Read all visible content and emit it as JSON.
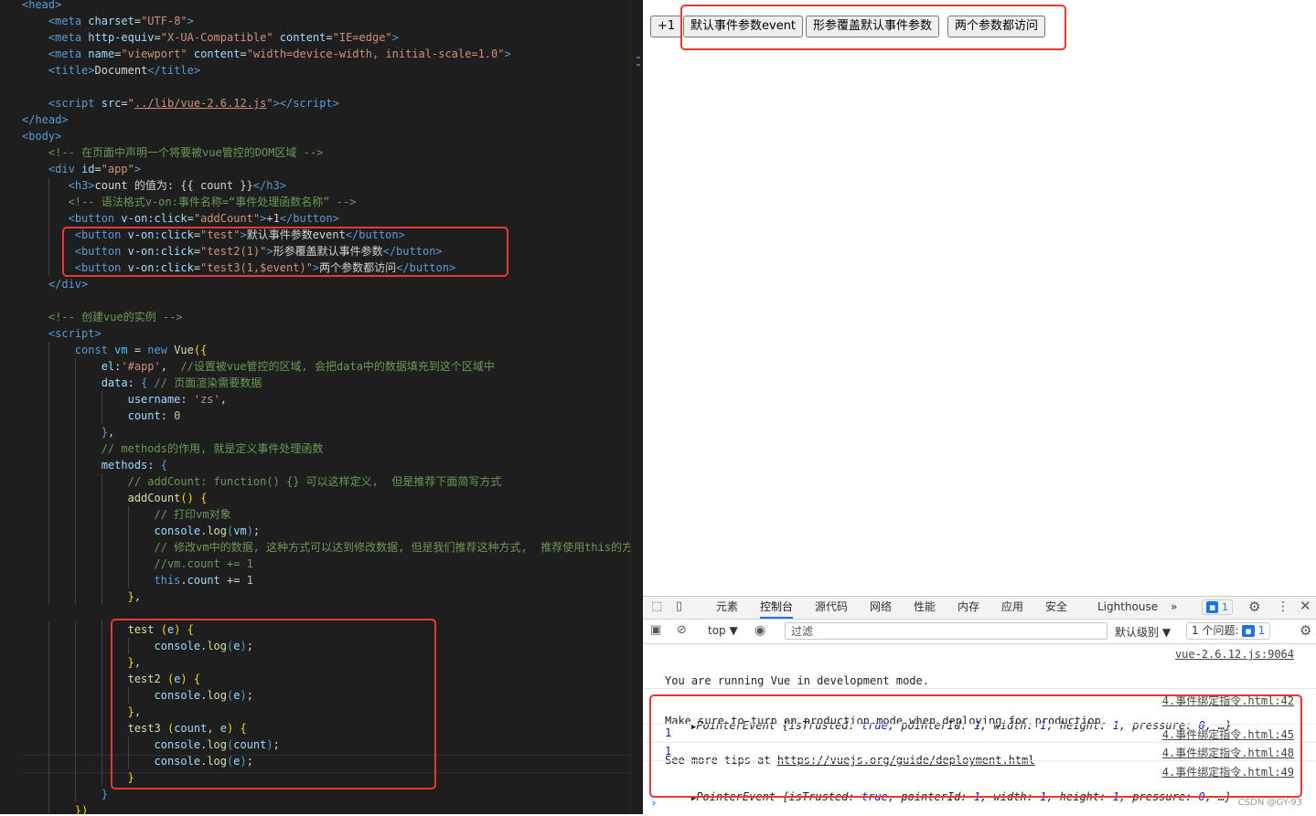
{
  "editor": {
    "lines": [
      [
        [
          "t",
          "<"
        ],
        [
          "t",
          "head"
        ],
        [
          "t",
          ">"
        ]
      ],
      [
        [
          "d",
          "    "
        ],
        [
          "t",
          "<"
        ],
        [
          "t",
          "meta "
        ],
        [
          "a",
          "charset"
        ],
        [
          "d",
          "="
        ],
        [
          "s",
          "\"UTF-8\""
        ],
        [
          "t",
          ">"
        ]
      ],
      [
        [
          "d",
          "    "
        ],
        [
          "t",
          "<"
        ],
        [
          "t",
          "meta "
        ],
        [
          "a",
          "http-equiv"
        ],
        [
          "d",
          "="
        ],
        [
          "s",
          "\"X-UA-Compatible\""
        ],
        [
          "d",
          " "
        ],
        [
          "a",
          "content"
        ],
        [
          "d",
          "="
        ],
        [
          "s",
          "\"IE=edge\""
        ],
        [
          "t",
          ">"
        ]
      ],
      [
        [
          "d",
          "    "
        ],
        [
          "t",
          "<"
        ],
        [
          "t",
          "meta "
        ],
        [
          "a",
          "name"
        ],
        [
          "d",
          "="
        ],
        [
          "s",
          "\"viewport\""
        ],
        [
          "d",
          " "
        ],
        [
          "a",
          "content"
        ],
        [
          "d",
          "="
        ],
        [
          "s",
          "\"width=device-width, initial-scale=1.0\""
        ],
        [
          "t",
          ">"
        ]
      ],
      [
        [
          "d",
          "    "
        ],
        [
          "t",
          "<"
        ],
        [
          "t",
          "title"
        ],
        [
          "t",
          ">"
        ],
        [
          "d",
          "Document"
        ],
        [
          "t",
          "</"
        ],
        [
          "t",
          "title"
        ],
        [
          "t",
          ">"
        ]
      ],
      [
        [
          "d",
          ""
        ]
      ],
      [
        [
          "d",
          "    "
        ],
        [
          "t",
          "<"
        ],
        [
          "t",
          "script "
        ],
        [
          "a",
          "src"
        ],
        [
          "d",
          "="
        ],
        [
          "s",
          "\""
        ],
        [
          "u",
          "../lib/vue-2.6.12.js"
        ],
        [
          "s",
          "\""
        ],
        [
          "t",
          "></"
        ],
        [
          "t",
          "script"
        ],
        [
          "t",
          ">"
        ]
      ],
      [
        [
          "t",
          "</"
        ],
        [
          "t",
          "head"
        ],
        [
          "t",
          ">"
        ]
      ],
      [
        [
          "t",
          "<"
        ],
        [
          "t",
          "body"
        ],
        [
          "t",
          ">"
        ]
      ],
      [
        [
          "d",
          "    "
        ],
        [
          "c",
          "<!-- 在页面中声明一个将要被vue管控的DOM区域 -->"
        ]
      ],
      [
        [
          "d",
          "    "
        ],
        [
          "t",
          "<"
        ],
        [
          "t",
          "div "
        ],
        [
          "a",
          "id"
        ],
        [
          "d",
          "="
        ],
        [
          "s",
          "\"app\""
        ],
        [
          "t",
          ">"
        ]
      ],
      [
        [
          "d",
          "       "
        ],
        [
          "t",
          "<"
        ],
        [
          "t",
          "h3"
        ],
        [
          "t",
          ">"
        ],
        [
          "d",
          "count 的值为: {{ count }}"
        ],
        [
          "t",
          "</"
        ],
        [
          "t",
          "h3"
        ],
        [
          "t",
          ">"
        ]
      ],
      [
        [
          "d",
          "       "
        ],
        [
          "c",
          "<!-- 语法格式v-on:事件名称=“事件处理函数名称” -->"
        ]
      ],
      [
        [
          "d",
          "       "
        ],
        [
          "t",
          "<"
        ],
        [
          "t",
          "button "
        ],
        [
          "a",
          "v-on:click"
        ],
        [
          "d",
          "="
        ],
        [
          "s",
          "\"addCount\""
        ],
        [
          "t",
          ">"
        ],
        [
          "d",
          "+1"
        ],
        [
          "t",
          "</"
        ],
        [
          "t",
          "button"
        ],
        [
          "t",
          ">"
        ]
      ],
      [
        [
          "d",
          "        "
        ],
        [
          "t",
          "<"
        ],
        [
          "t",
          "button "
        ],
        [
          "a",
          "v-on:click"
        ],
        [
          "d",
          "="
        ],
        [
          "s",
          "\"test\""
        ],
        [
          "t",
          ">"
        ],
        [
          "d",
          "默认事件参数event"
        ],
        [
          "t",
          "</"
        ],
        [
          "t",
          "button"
        ],
        [
          "t",
          ">"
        ]
      ],
      [
        [
          "d",
          "        "
        ],
        [
          "t",
          "<"
        ],
        [
          "t",
          "button "
        ],
        [
          "a",
          "v-on:click"
        ],
        [
          "d",
          "="
        ],
        [
          "s",
          "\"test2(1)\""
        ],
        [
          "t",
          ">"
        ],
        [
          "d",
          "形参覆盖默认事件参数"
        ],
        [
          "t",
          "</"
        ],
        [
          "t",
          "button"
        ],
        [
          "t",
          ">"
        ]
      ],
      [
        [
          "d",
          "        "
        ],
        [
          "t",
          "<"
        ],
        [
          "t",
          "button "
        ],
        [
          "a",
          "v-on:click"
        ],
        [
          "d",
          "="
        ],
        [
          "s",
          "\"test3(1,$event)\""
        ],
        [
          "t",
          ">"
        ],
        [
          "d",
          "两个参数都访问"
        ],
        [
          "t",
          "</"
        ],
        [
          "t",
          "button"
        ],
        [
          "t",
          ">"
        ]
      ],
      [
        [
          "d",
          "    "
        ],
        [
          "t",
          "</"
        ],
        [
          "t",
          "div"
        ],
        [
          "t",
          ">"
        ]
      ],
      [
        [
          "d",
          ""
        ]
      ],
      [
        [
          "d",
          "    "
        ],
        [
          "c",
          "<!-- 创建vue的实例 -->"
        ]
      ],
      [
        [
          "d",
          "    "
        ],
        [
          "t",
          "<"
        ],
        [
          "t",
          "script"
        ],
        [
          "t",
          ">"
        ]
      ],
      [
        [
          "d",
          "        "
        ],
        [
          "k",
          "const "
        ],
        [
          "v",
          "vm"
        ],
        [
          "d",
          " = "
        ],
        [
          "k",
          "new "
        ],
        [
          "f",
          "Vue"
        ],
        [
          "y",
          "({"
        ]
      ],
      [
        [
          "d",
          "            "
        ],
        [
          "a",
          "el"
        ],
        [
          "d",
          ":"
        ],
        [
          "s",
          "'#app'"
        ],
        [
          "d",
          ",  "
        ],
        [
          "c",
          "//设置被vue管控的区域, 会把data中的数据填充到这个区域中"
        ]
      ],
      [
        [
          "d",
          "            "
        ],
        [
          "a",
          "data"
        ],
        [
          "d",
          ": "
        ],
        [
          "k",
          "{"
        ],
        [
          "d",
          " "
        ],
        [
          "c",
          "// 页面渲染需要数据"
        ]
      ],
      [
        [
          "d",
          "                "
        ],
        [
          "a",
          "username"
        ],
        [
          "d",
          ": "
        ],
        [
          "s",
          "'zs'"
        ],
        [
          "d",
          ","
        ]
      ],
      [
        [
          "d",
          "                "
        ],
        [
          "a",
          "count"
        ],
        [
          "d",
          ": "
        ],
        [
          "n",
          "0"
        ]
      ],
      [
        [
          "d",
          "            "
        ],
        [
          "k",
          "}"
        ],
        [
          "d",
          ","
        ]
      ],
      [
        [
          "d",
          "            "
        ],
        [
          "c",
          "// methods的作用, 就是定义事件处理函数"
        ]
      ],
      [
        [
          "d",
          "            "
        ],
        [
          "a",
          "methods"
        ],
        [
          "d",
          ": "
        ],
        [
          "k",
          "{"
        ]
      ],
      [
        [
          "d",
          "                "
        ],
        [
          "c",
          "// addCount: function() {} 可以这样定义,  但是推荐下面简写方式"
        ]
      ],
      [
        [
          "d",
          "                "
        ],
        [
          "f",
          "addCount"
        ],
        [
          "y",
          "()"
        ],
        [
          "d",
          " "
        ],
        [
          "y",
          "{"
        ]
      ],
      [
        [
          "d",
          "                    "
        ],
        [
          "c",
          "// 打印vm对象"
        ]
      ],
      [
        [
          "d",
          "                    "
        ],
        [
          "a",
          "console"
        ],
        [
          "d",
          "."
        ],
        [
          "f",
          "log"
        ],
        [
          "k",
          "("
        ],
        [
          "a",
          "vm"
        ],
        [
          "k",
          ")"
        ],
        [
          "d",
          ";"
        ]
      ],
      [
        [
          "d",
          "                    "
        ],
        [
          "c",
          "// 修改vm中的数据, 这种方式可以达到修改数据, 但是我们推荐这种方式,  推荐使用this的方"
        ]
      ],
      [
        [
          "d",
          "                    "
        ],
        [
          "c",
          "//vm.count += 1"
        ]
      ],
      [
        [
          "d",
          "                    "
        ],
        [
          "k",
          "this"
        ],
        [
          "d",
          "."
        ],
        [
          "a",
          "count"
        ],
        [
          "d",
          " += "
        ],
        [
          "n",
          "1"
        ]
      ],
      [
        [
          "d",
          "                "
        ],
        [
          "y",
          "}"
        ],
        [
          "d",
          ","
        ]
      ],
      [
        [
          "d",
          ""
        ]
      ],
      [
        [
          "d",
          "                "
        ],
        [
          "f",
          "test"
        ],
        [
          "d",
          " "
        ],
        [
          "y",
          "("
        ],
        [
          "a",
          "e"
        ],
        [
          "y",
          ")"
        ],
        [
          "d",
          " "
        ],
        [
          "y",
          "{"
        ]
      ],
      [
        [
          "d",
          "                    "
        ],
        [
          "a",
          "console"
        ],
        [
          "d",
          "."
        ],
        [
          "f",
          "log"
        ],
        [
          "k",
          "("
        ],
        [
          "a",
          "e"
        ],
        [
          "k",
          ")"
        ],
        [
          "d",
          ";"
        ]
      ],
      [
        [
          "d",
          "                "
        ],
        [
          "y",
          "}"
        ],
        [
          "d",
          ","
        ]
      ],
      [
        [
          "d",
          "                "
        ],
        [
          "f",
          "test2"
        ],
        [
          "d",
          " "
        ],
        [
          "y",
          "("
        ],
        [
          "a",
          "e"
        ],
        [
          "y",
          ")"
        ],
        [
          "d",
          " "
        ],
        [
          "y",
          "{"
        ]
      ],
      [
        [
          "d",
          "                    "
        ],
        [
          "a",
          "console"
        ],
        [
          "d",
          "."
        ],
        [
          "f",
          "log"
        ],
        [
          "k",
          "("
        ],
        [
          "a",
          "e"
        ],
        [
          "k",
          ")"
        ],
        [
          "d",
          ";"
        ]
      ],
      [
        [
          "d",
          "                "
        ],
        [
          "y",
          "}"
        ],
        [
          "d",
          ","
        ]
      ],
      [
        [
          "d",
          "                "
        ],
        [
          "f",
          "test3"
        ],
        [
          "d",
          " "
        ],
        [
          "y",
          "("
        ],
        [
          "a",
          "count"
        ],
        [
          "d",
          ", "
        ],
        [
          "a",
          "e"
        ],
        [
          "y",
          ")"
        ],
        [
          "d",
          " "
        ],
        [
          "y",
          "{"
        ]
      ],
      [
        [
          "d",
          "                    "
        ],
        [
          "a",
          "console"
        ],
        [
          "d",
          "."
        ],
        [
          "f",
          "log"
        ],
        [
          "k",
          "("
        ],
        [
          "a",
          "count"
        ],
        [
          "k",
          ")"
        ],
        [
          "d",
          ";"
        ]
      ],
      [
        [
          "d",
          "                    "
        ],
        [
          "a",
          "console"
        ],
        [
          "d",
          "."
        ],
        [
          "f",
          "log"
        ],
        [
          "k",
          "("
        ],
        [
          "a",
          "e"
        ],
        [
          "k",
          ")"
        ],
        [
          "d",
          ";"
        ]
      ],
      [
        [
          "d",
          "                "
        ],
        [
          "y",
          "}"
        ]
      ],
      [
        [
          "d",
          "            "
        ],
        [
          "k",
          "}"
        ]
      ],
      [
        [
          "d",
          "        "
        ],
        [
          "y",
          "})"
        ]
      ]
    ]
  },
  "page": {
    "buttons": [
      "+1",
      "默认事件参数event",
      "形参覆盖默认事件参数",
      "两个参数都访问"
    ]
  },
  "devtools": {
    "tabs": [
      "元素",
      "控制台",
      "源代码",
      "网络",
      "性能",
      "内存",
      "应用",
      "安全",
      "Lighthouse"
    ],
    "active_tab": "控制台",
    "more": "»",
    "issue_count": "1",
    "context": "top ▼",
    "filter_placeholder": "过滤",
    "levels": "默认级别 ▼",
    "issues_label": "1 个问题:",
    "issues_count": "1",
    "vue_msg": [
      "You are running Vue in development mode.",
      "Make sure to turn on production mode when deploying for production.",
      "See more tips at "
    ],
    "vue_link": "https://vuejs.org/guide/deployment.html",
    "vue_src": "vue-2.6.12.js:9064",
    "logs": [
      {
        "src": "4.事件绑定指令.html:42"
      },
      {
        "value": "1",
        "src": "4.事件绑定指令.html:45"
      },
      {
        "value": "1",
        "src": "4.事件绑定指令.html:48"
      },
      {
        "src": "4.事件绑定指令.html:49"
      }
    ],
    "event_obj": {
      "name": "PointerEvent",
      "open": " {",
      "k1": "isTrusted",
      "v1": "true",
      "k2": "pointerId",
      "v2": "1",
      "k3": "width",
      "v3": "1",
      "k4": "height",
      "v4": "1",
      "k5": "pressure",
      "v5": "0",
      "close": ", …}"
    },
    "prompt": "›"
  },
  "watermark": "CSDN @GY-93"
}
